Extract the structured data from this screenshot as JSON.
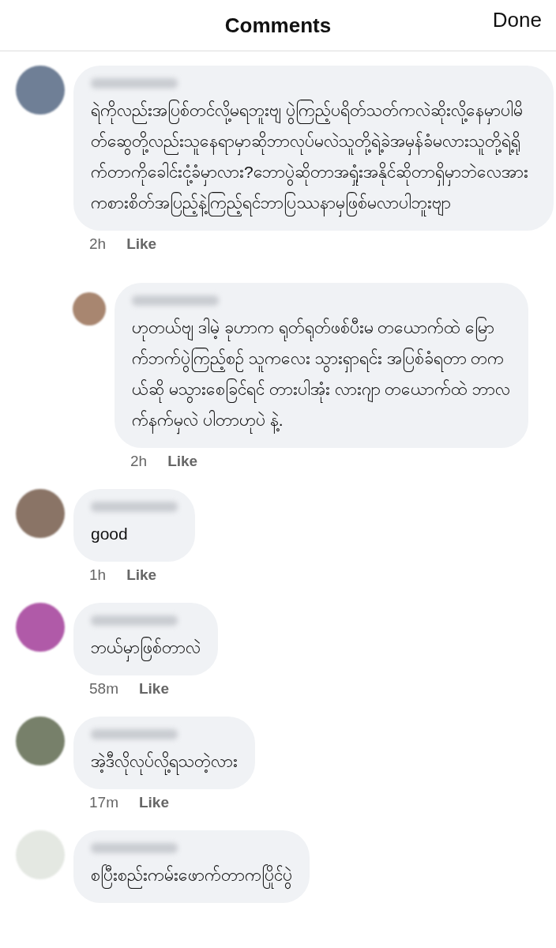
{
  "header": {
    "title": "Comments",
    "done_button": "Done"
  },
  "comments": [
    {
      "color": "#6f7f96",
      "text": "ရဲကိုလည်းအပြစ်တင်လို့မရဘူးဗျ ပွဲကြည့်ပရိတ်သတ်ကလဲဆိုးလို့နေမှာပါမိတ်ဆွေတို့လည်းသူနေရာမှာဆိုဘာလုပ်မလဲသူတို့ရဲ့ခဲအမှန်ခံမလားသူတို့ရဲ့ရိုက်တာကိုခေါင်းငုံ့ခံမှာလား?ဘောပွဲဆိုတာအရှုံးအနိုင်ဆိုတာရှိမှာဘဲလေအားကစားစိတ်အပြည့်နဲ့ကြည့်ရင်ဘာပြဿနာမှဖြစ်မလာပါဘူးဗျာ",
      "time": "2h",
      "like": "Like",
      "replies": [
        {
          "color": "#a88670",
          "text": "ဟုတယ်ဗျ ဒါမဲ့ ခုဟာက ရုတ်ရုတ်ဖစ်ပီးမ တယောက်ထဲ မြောက်ဘက်ပွဲကြည့်စဉ် သူကလေး သွားရှာရင်း အပြစ်ခံရတာ တကယ်ဆို မသွားစေခြင်ရင် တားပါအုံး လားဂျာ တယောက်ထဲ ဘာလက်နက်မှလဲ ပါတာဟုပဲ နဲ့.",
          "time": "2h",
          "like": "Like"
        }
      ]
    },
    {
      "color": "#8a7466",
      "text": "good",
      "time": "1h",
      "like": "Like"
    },
    {
      "color": "#b05aa8",
      "text": "ဘယ်မှာဖြစ်တာလဲ",
      "time": "58m",
      "like": "Like"
    },
    {
      "color": "#77806a",
      "text": "အဲ့ဒီလိုလုပ်လို့ရသတဲ့လား",
      "time": "17m",
      "like": "Like"
    },
    {
      "color": "#e4e8e2",
      "text": "စပြီးစည်းကမ်းဖောက်တာကပြိုင်ပွဲ"
    }
  ]
}
